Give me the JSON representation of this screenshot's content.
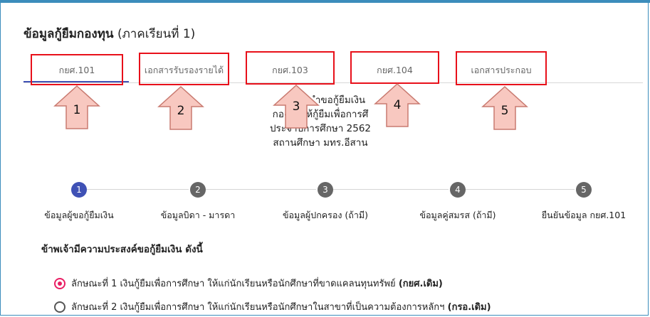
{
  "header": {
    "title": "ข้อมูลกู้ยืมกองทุน",
    "subtitle": "(ภาคเรียนที่ 1)"
  },
  "tabs": [
    {
      "label": "กยศ.101",
      "active": true
    },
    {
      "label": "เอกสารรับรองรายได้",
      "active": false
    },
    {
      "label": "กยศ.103",
      "active": false
    },
    {
      "label": "กยศ.104",
      "active": false
    },
    {
      "label": "เอกสารประกอบ",
      "active": false
    }
  ],
  "annotations": {
    "arrow_numbers": [
      "1",
      "2",
      "3",
      "4",
      "5"
    ],
    "arrow_color": "#f8c8c0",
    "box_color": "#e8101a"
  },
  "form_header": {
    "line1": "ำขอกู้ยืมเงิน",
    "line2": "กองทุนให้กู้ยืมเพื่อการศึ",
    "line3": "ประจำปีการศึกษา 2562",
    "line4": "สถานศึกษา มทร.อีสาน"
  },
  "stepper": {
    "active_color": "#3f51b5",
    "steps": [
      {
        "num": "1",
        "label": "ข้อมูลผู้ขอกู้ยืมเงิน",
        "active": true
      },
      {
        "num": "2",
        "label": "ข้อมูลบิดา - มารดา",
        "active": false
      },
      {
        "num": "3",
        "label": "ข้อมูลผู้ปกครอง (ถ้ามี)",
        "active": false
      },
      {
        "num": "4",
        "label": "ข้อมูลคู่สมรส (ถ้ามี)",
        "active": false
      },
      {
        "num": "5",
        "label": "ยืนยันข้อมูล กยศ.101",
        "active": false
      }
    ]
  },
  "question": "ข้าพเจ้ามีความประสงค์ขอกู้ยืมเงิน ดังนี้",
  "options": [
    {
      "text": "ลักษณะที่ 1 เงินกู้ยืมเพื่อการศึกษา ให้แก่นักเรียนหรือนักศึกษาที่ขาดแคลนทุนทรัพย์",
      "tag": "(กยศ.เดิม)",
      "checked": true
    },
    {
      "text": "ลักษณะที่ 2 เงินกู้ยืมเพื่อการศึกษา ให้แก่นักเรียนหรือนักศึกษาในสาขาที่เป็นความต้องการหลักฯ",
      "tag": "(กรอ.เดิม)",
      "checked": false
    }
  ]
}
